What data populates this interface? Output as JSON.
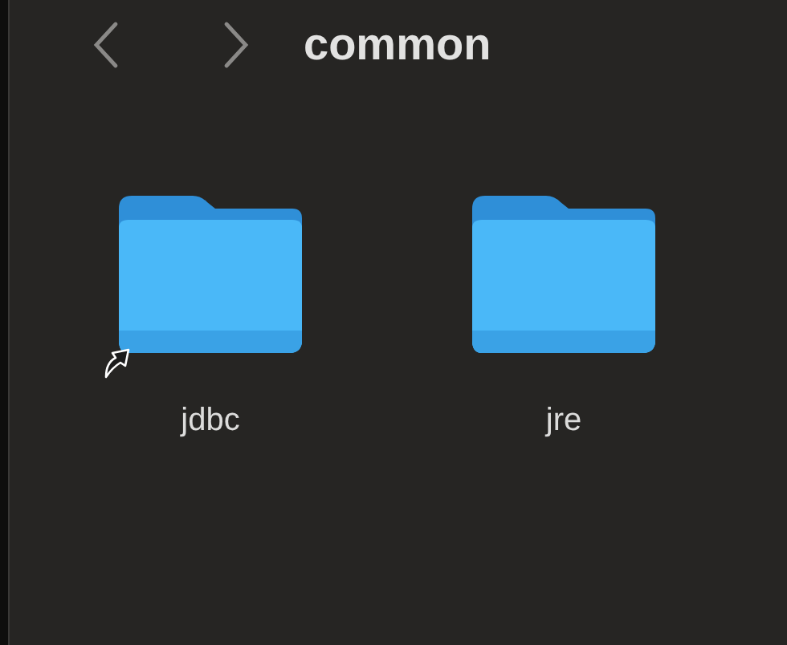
{
  "toolbar": {
    "title": "common"
  },
  "items": [
    {
      "name": "jdbc",
      "alias": true
    },
    {
      "name": "jre",
      "alias": false
    }
  ]
}
